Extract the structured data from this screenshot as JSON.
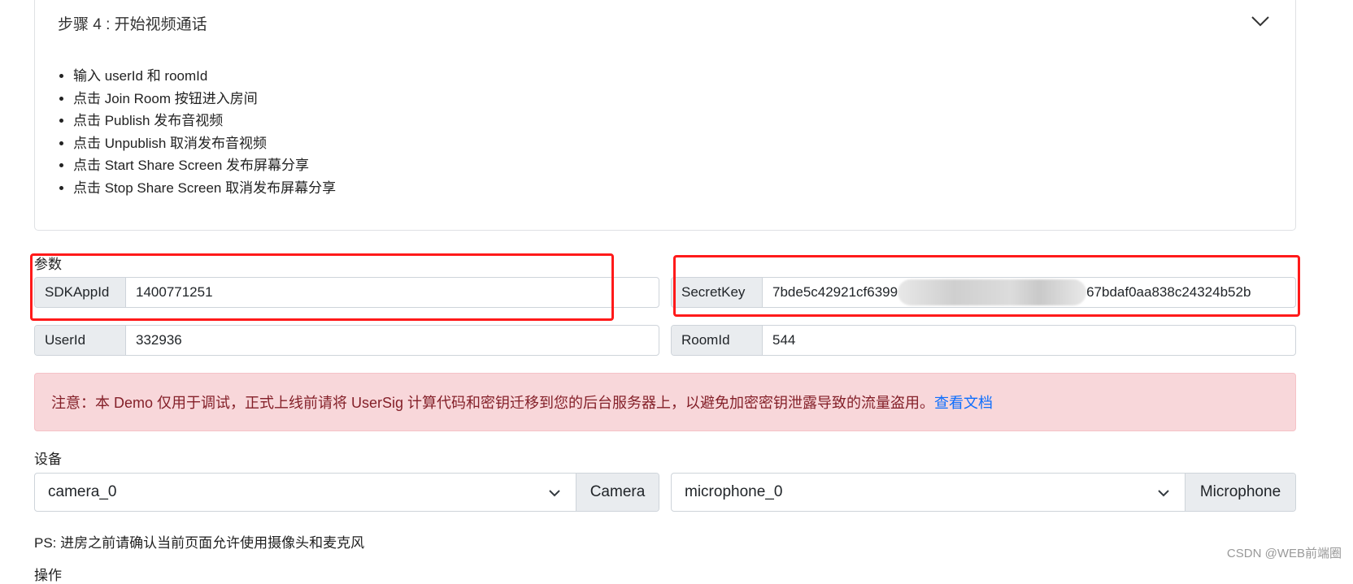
{
  "step_panel": {
    "title": "步骤 4 : 开始视频通话",
    "icon": "chevron-down-icon",
    "items": [
      "输入 userId 和 roomId",
      "点击 Join Room 按钮进入房间",
      "点击 Publish 发布音视频",
      "点击 Unpublish 取消发布音视频",
      "点击 Start Share Screen 发布屏幕分享",
      "点击 Stop Share Screen 取消发布屏幕分享"
    ]
  },
  "params": {
    "label": "参数",
    "sdk_app_id": {
      "label": "SDKAppId",
      "value": "1400771251"
    },
    "secret_key": {
      "label": "SecretKey",
      "value_start": "7bde5c42921cf6399",
      "value_end": "67bdaf0aa838c24324b52b"
    },
    "user_id": {
      "label": "UserId",
      "value": "332936"
    },
    "room_id": {
      "label": "RoomId",
      "value": "544"
    }
  },
  "alert": {
    "text": "注意：本 Demo 仅用于调试，正式上线前请将 UserSig 计算代码和密钥迁移到您的后台服务器上，以避免加密密钥泄露导致的流量盗用。",
    "link": "查看文档"
  },
  "devices": {
    "label": "设备",
    "camera": {
      "value": "camera_0",
      "addon": "Camera"
    },
    "microphone": {
      "value": "microphone_0",
      "addon": "Microphone"
    },
    "note": "PS: 进房之前请确认当前页面允许使用摄像头和麦克风"
  },
  "next_section_label": "操作",
  "watermark": "CSDN @WEB前端圈",
  "colors": {
    "highlight": "#ff1a1a",
    "alert_bg": "#f8d7da",
    "alert_text": "#842029",
    "link": "#0d6efd"
  }
}
